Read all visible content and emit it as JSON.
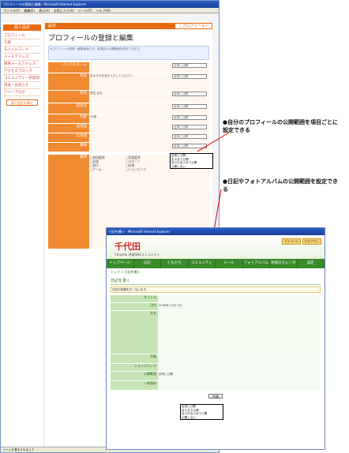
{
  "win1": {
    "title": "プロフィールの登録と編集 - Microsoft Internet Explorer",
    "menu": [
      "ファイル(F)",
      "編集(E)",
      "表示(V)",
      "お気に入り(A)",
      "ツール(T)",
      "ヘルプ(H)"
    ],
    "sidebar": {
      "header": "個人設定",
      "items": [
        "プロフィール",
        "写真",
        "モバイルコード",
        "メールアドレス",
        "携帯メールアドレス",
        "アクセスブロック",
        "コミュニティー参加状況確認",
        "退会・お知らせ",
        "フリーブログ"
      ],
      "button": "個人設定を開く"
    },
    "section_title": "設定",
    "section_link": "［プロフィール］",
    "page_title": "プロフィールの登録と編集",
    "note": "※プロフィール登録・編集画面です。各項目の公開範囲を設定できます。",
    "rows": [
      {
        "label": "ハンドルネーム",
        "text": "",
        "select": "全体に公開"
      },
      {
        "label": "氏名",
        "text": "あなたの氏名を入力してください",
        "select": "全体に公開"
      },
      {
        "label": "性別",
        "text": "男性  女性",
        "select": "全体に公開"
      },
      {
        "label": "誕生日",
        "text": "",
        "select": "全体に公開"
      },
      {
        "label": "年齢",
        "text": "45歳",
        "select": "全体に公開"
      },
      {
        "label": "血液型",
        "text": "",
        "select": "全体に公開"
      },
      {
        "label": "出身地",
        "text": "",
        "select": "全体に公開"
      },
      {
        "label": "趣味",
        "text": "",
        "select": "全体に公開"
      }
    ],
    "hobbies": [
      "映画鑑賞",
      "音楽鑑賞",
      "読書",
      "スポーツ",
      "旅行",
      "料理",
      "ゲーム",
      "ショッピング"
    ],
    "dropdown": [
      "全体に公開",
      "友人まで公開",
      "友人の友人まで公開",
      "公開しない"
    ]
  },
  "ann1": "●自分のプロフィールの公開範囲を項目ごとに設定できる",
  "ann2": "●日記やフォトアルバムの公開範囲を設定できる",
  "win2": {
    "logo": "千代田",
    "logo_sub": "Chiyoda 地域SNSコミュニティ",
    "top_buttons": [
      "マイページ",
      "ログアウト"
    ],
    "nav": [
      "トップページ",
      "日記",
      "ともだち",
      "コミュニティ",
      "メール",
      "フォトアルバム",
      "地域のカレンダー",
      "設定"
    ],
    "breadcrumb": "トップ > 日記を書く",
    "diary_title": "日記を書く",
    "info": "日記の投稿をおこないます。",
    "rows": [
      {
        "label": "タイトル",
        "text": ""
      },
      {
        "label": "日付",
        "text": "2006年 10月 1日"
      },
      {
        "label": "本文",
        "text": ""
      },
      {
        "label": "写真",
        "text": ""
      },
      {
        "label": "トラックバック",
        "text": ""
      },
      {
        "label": "公開範囲",
        "text": "全体に公開"
      },
      {
        "label": "一時保存",
        "text": ""
      }
    ],
    "dropdown": [
      "全体に公開",
      "友人まで公開",
      "友人の友人まで公開",
      "公開しない"
    ],
    "submit": "投稿"
  }
}
